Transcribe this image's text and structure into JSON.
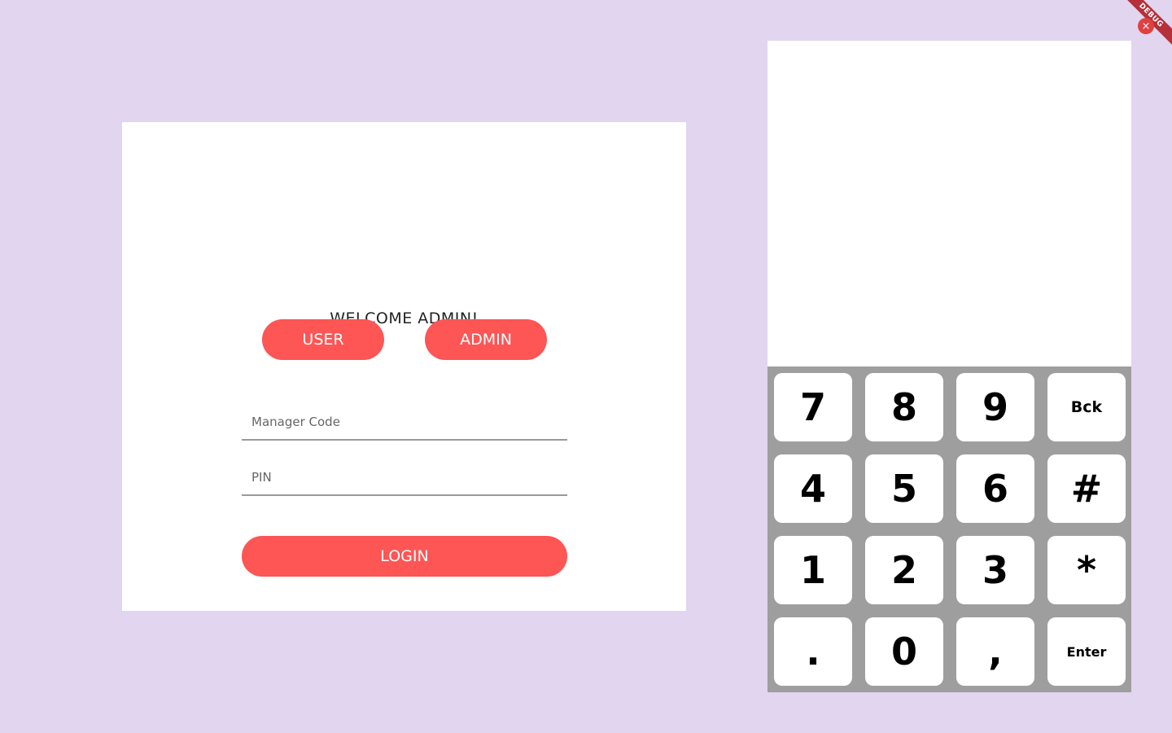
{
  "login": {
    "welcome": "WELCOME ADMIN!",
    "user_button": "USER",
    "admin_button": "ADMIN",
    "manager_code_placeholder": "Manager Code",
    "pin_placeholder": "PIN",
    "login_button": "LOGIN"
  },
  "keypad": {
    "row1": [
      "7",
      "8",
      "9",
      "Bck"
    ],
    "row2": [
      "4",
      "5",
      "6",
      "#"
    ],
    "row3": [
      "1",
      "2",
      "3",
      "*"
    ],
    "row4": [
      ".",
      "0",
      ",",
      "Enter"
    ]
  },
  "debug": {
    "banner": "DEBUG",
    "close_glyph": "×"
  },
  "colors": {
    "background": "#e1d5f0",
    "accent": "#fe5555",
    "keypad_bg": "#9e9e9e"
  }
}
